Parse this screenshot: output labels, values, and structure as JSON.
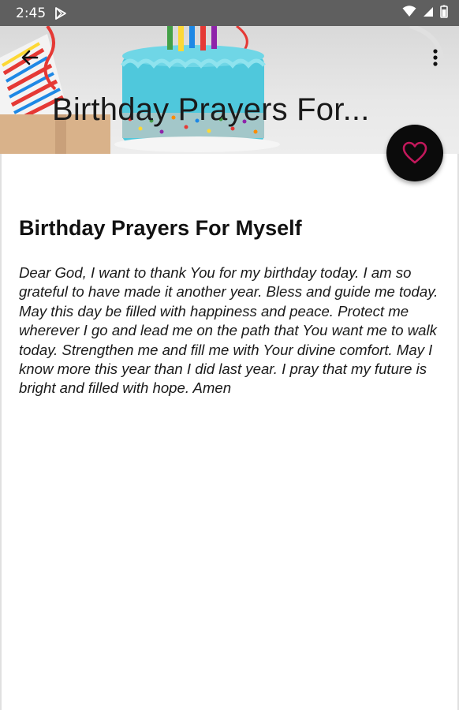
{
  "status_bar": {
    "time": "2:45",
    "icons": [
      "play-store-icon",
      "wifi-icon",
      "signal-icon",
      "battery-icon"
    ]
  },
  "toolbar": {
    "title": "Birthday Prayers For...",
    "back_icon": "arrow-back-icon",
    "more_icon": "more-vert-icon"
  },
  "fab": {
    "icon": "heart-outline-icon",
    "icon_color": "#c2185b"
  },
  "article": {
    "title": "Birthday Prayers For Myself",
    "body": "Dear God, I want to thank You for my birthday today. I am so grateful to have made it another year. Bless and guide me today. May this day be filled with happiness and peace. Protect me wherever I go and lead me on the path that You want me to walk today. Strengthen me and fill me with Your divine comfort. May I know more this year than I did last year. I pray that my future is bright and filled with hope. Amen"
  },
  "colors": {
    "status_bar": "#5f5f5f",
    "fab_background": "#0b0b0b",
    "cake_frosting": "#4fc8dc"
  }
}
